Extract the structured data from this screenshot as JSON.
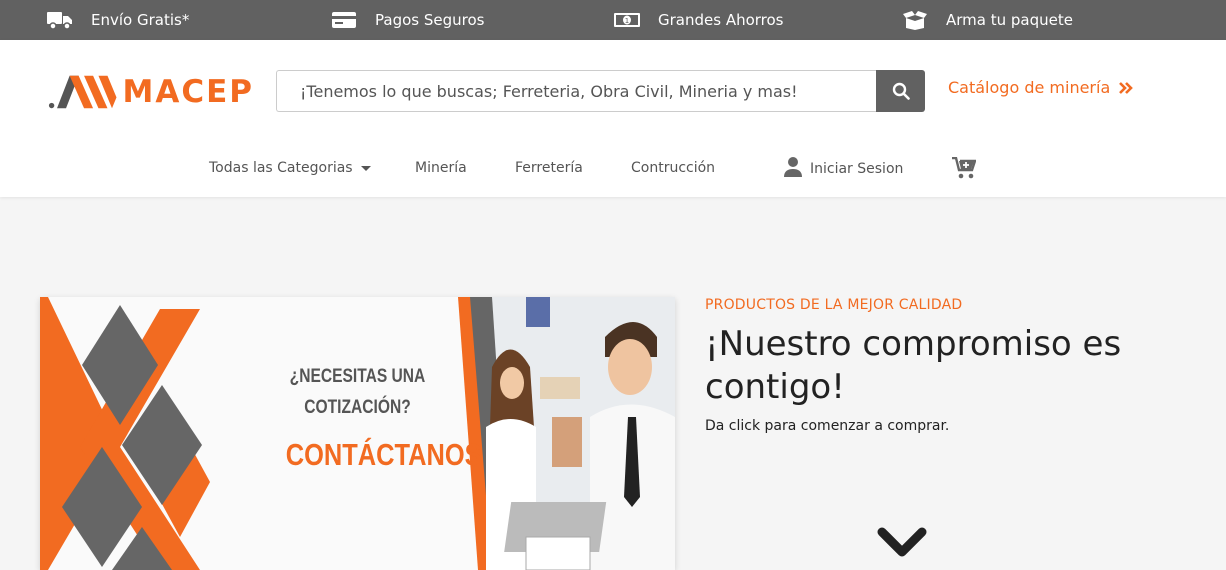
{
  "topbar": {
    "items": [
      {
        "label": "Envío Gratis*",
        "icon": "truck-icon"
      },
      {
        "label": "Pagos Seguros",
        "icon": "credit-card-icon"
      },
      {
        "label": "Grandes Ahorros",
        "icon": "money-bill-icon"
      },
      {
        "label": "Arma tu paquete",
        "icon": "box-open-icon"
      }
    ]
  },
  "header": {
    "logo_text": "MACEP",
    "search": {
      "placeholder": "¡Tenemos lo que buscas; Ferreteria, Obra Civil, Mineria y mas!"
    },
    "catalog_link": "Catálogo de minería"
  },
  "nav": {
    "items": [
      "Todas las Categorias",
      "Minería",
      "Ferretería",
      "Contrucción"
    ],
    "login": "Iniciar Sesion"
  },
  "banner": {
    "question": "¿NECESITAS UNA COTIZACIÓN?",
    "cta": "CONTÁCTANOS"
  },
  "hero": {
    "eyebrow": "PRODUCTOS DE LA MEJOR CALIDAD",
    "title": "¡Nuestro compromiso es contigo!",
    "subtitle": "Da click para comenzar a comprar."
  },
  "colors": {
    "brand": "#f26b21",
    "topbar": "#616161",
    "gray": "#666666"
  }
}
